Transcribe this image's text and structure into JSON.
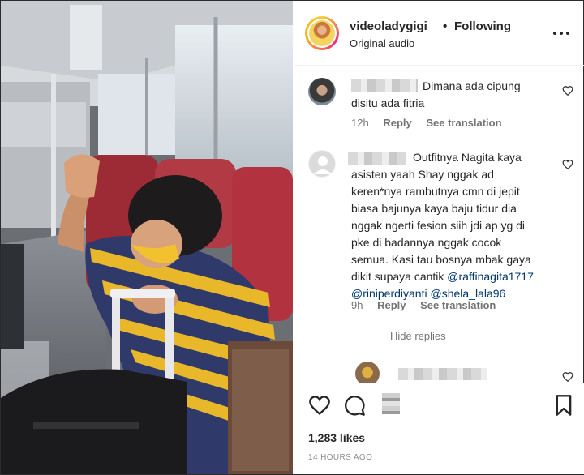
{
  "post": {
    "username": "videoladygigi",
    "separator": "•",
    "follow_status": "Following",
    "audio": "Original audio"
  },
  "comments": [
    {
      "text": "Dimana ada cipung disitu ada fitria",
      "time": "12h",
      "reply": "Reply",
      "translation": "See translation"
    },
    {
      "text_lines": [
        "Outfitnya Nagita kaya",
        "asisten yaah Shay nggak ad",
        "keren*nya rambutnya cmn di jepit",
        "biasa bajunya kaya baju tidur dia",
        "nggak ngerti fesion siih jdi ap yg di",
        "pke di badannya nggak cocok",
        "semua. Kasi tau bosnya mbak gaya",
        "dikit supaya cantik"
      ],
      "mentions": [
        "@raffinagita1717",
        "@riniperdiyanti",
        "@shela_lala96"
      ],
      "time": "9h",
      "reply": "Reply",
      "translation": "See translation"
    }
  ],
  "hide_replies": "Hide replies",
  "likes": "1,283 likes",
  "timestamp": "14 HOURS AGO",
  "colors": {
    "mention": "#00376b",
    "meta": "#737373",
    "text": "#262626"
  }
}
